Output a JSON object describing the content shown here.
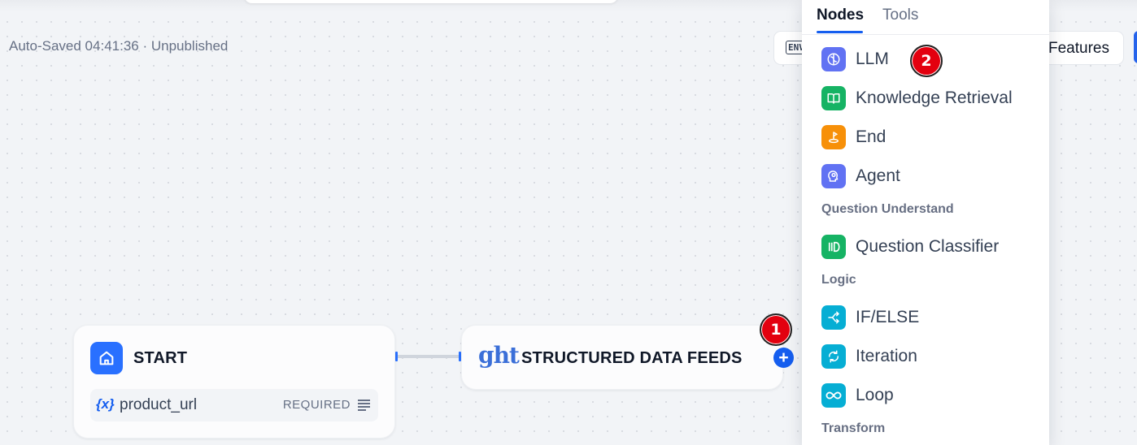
{
  "header": {
    "autosave_text": "Auto-Saved 04:41:36 · Unpublished",
    "env_label": "ENV",
    "features_label": "Features"
  },
  "canvas": {
    "start_node": {
      "title": "START",
      "variable": {
        "icon": "{x}",
        "name": "product_url",
        "badge": "REQUIRED"
      }
    },
    "structured_node": {
      "logo_text": "ght",
      "title": "STRUCTURED DATA FEEDS"
    },
    "add_button": "+"
  },
  "annotations": {
    "marker_1": "1",
    "marker_2": "2"
  },
  "panel": {
    "tabs": [
      {
        "label": "Nodes",
        "active": true
      },
      {
        "label": "Tools",
        "active": false
      }
    ],
    "items_group_1": [
      {
        "label": "LLM",
        "icon": "llm-icon",
        "color": "#6172f3"
      },
      {
        "label": "Knowledge Retrieval",
        "icon": "book-icon",
        "color": "#16b364"
      },
      {
        "label": "End",
        "icon": "end-icon",
        "color": "#f79009"
      },
      {
        "label": "Agent",
        "icon": "agent-icon",
        "color": "#6172f3"
      }
    ],
    "section_question": "Question Understand",
    "items_group_2": [
      {
        "label": "Question Classifier",
        "icon": "classifier-icon",
        "color": "#16b364"
      }
    ],
    "section_logic": "Logic",
    "items_group_3": [
      {
        "label": "IF/ELSE",
        "icon": "branch-icon",
        "color": "#06aed4"
      },
      {
        "label": "Iteration",
        "icon": "iteration-icon",
        "color": "#06aed4"
      },
      {
        "label": "Loop",
        "icon": "loop-icon",
        "color": "#06aed4"
      }
    ],
    "section_transform": "Transform"
  }
}
